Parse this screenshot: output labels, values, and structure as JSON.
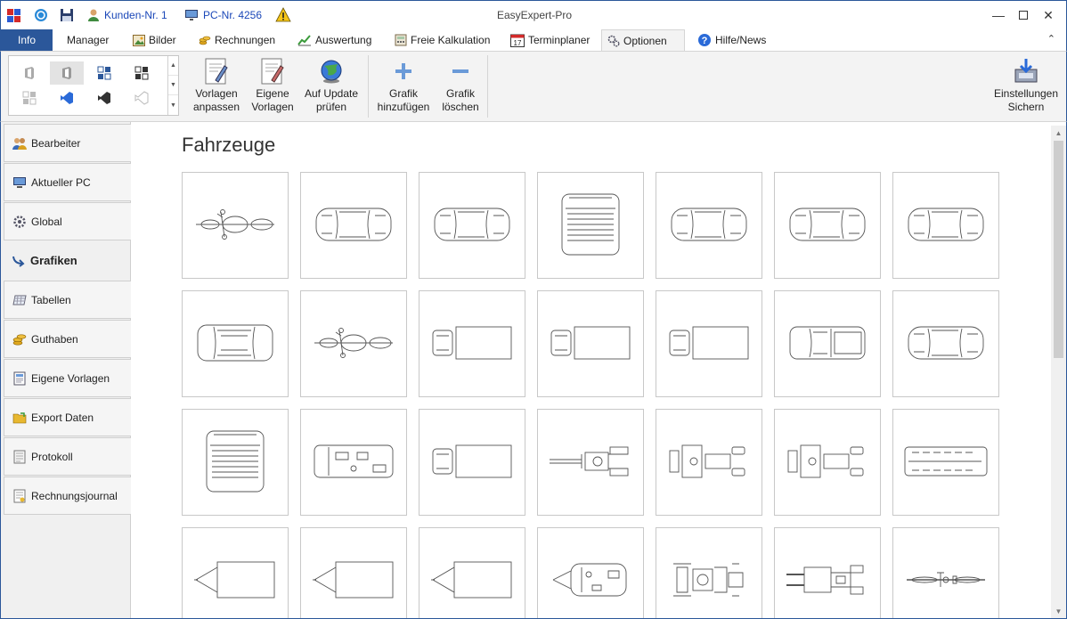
{
  "window": {
    "title": "EasyExpert-Pro"
  },
  "quick_access": {
    "customer_label": "Kunden-Nr. 1",
    "pc_label": "PC-Nr. 4256"
  },
  "tabs": [
    {
      "label": "Info",
      "icon": ""
    },
    {
      "label": "Manager",
      "icon": ""
    },
    {
      "label": "Bilder",
      "icon": "image-icon"
    },
    {
      "label": "Rechnungen",
      "icon": "coins-icon"
    },
    {
      "label": "Auswertung",
      "icon": "chart-icon"
    },
    {
      "label": "Freie Kalkulation",
      "icon": "calculator-icon"
    },
    {
      "label": "Terminplaner",
      "icon": "calendar-icon"
    },
    {
      "label": "Optionen",
      "icon": "gears-icon"
    },
    {
      "label": "Hilfe/News",
      "icon": "help-icon"
    }
  ],
  "calendar_day": "17",
  "ribbon": {
    "vorlagen_anpassen": [
      "Vorlagen",
      "anpassen"
    ],
    "eigene_vorlagen": [
      "Eigene",
      "Vorlagen"
    ],
    "auf_update": [
      "Auf Update",
      "prüfen"
    ],
    "grafik_hinzu": [
      "Grafik",
      "hinzufügen"
    ],
    "grafik_loeschen": [
      "Grafik",
      "löschen"
    ],
    "einstellungen": [
      "Einstellungen",
      "Sichern"
    ]
  },
  "sidebar": [
    {
      "label": "Bearbeiter",
      "icon": "users-icon"
    },
    {
      "label": "Aktueller PC",
      "icon": "monitor-icon"
    },
    {
      "label": "Global",
      "icon": "gear-icon"
    },
    {
      "label": "Grafiken",
      "icon": "arrow-icon",
      "active": true
    },
    {
      "label": "Tabellen",
      "icon": "table-icon"
    },
    {
      "label": "Guthaben",
      "icon": "coins-icon"
    },
    {
      "label": "Eigene Vorlagen",
      "icon": "document-icon"
    },
    {
      "label": "Export Daten",
      "icon": "folder-icon"
    },
    {
      "label": "Protokoll",
      "icon": "log-icon"
    },
    {
      "label": "Rechnungsjournal",
      "icon": "journal-icon"
    }
  ],
  "main": {
    "heading": "Fahrzeuge",
    "tiles": [
      "motorcycle-top",
      "car-top",
      "car-top",
      "van-top",
      "car-top",
      "car-top",
      "car-top",
      "suv-top",
      "motorcycle-top",
      "truck-top",
      "truck-top",
      "truck-top",
      "pickup-top",
      "car-top",
      "van-top",
      "camper-top",
      "truck-top",
      "excavator-top",
      "tractor-top",
      "tractor-top",
      "bus-top",
      "trailer-top",
      "trailer-top",
      "trailer-top",
      "caravan-top",
      "machine-top",
      "forklift-top",
      "bicycle-top"
    ]
  },
  "colors": {
    "accent": "#2b579a",
    "background": "#f3f3f3"
  }
}
